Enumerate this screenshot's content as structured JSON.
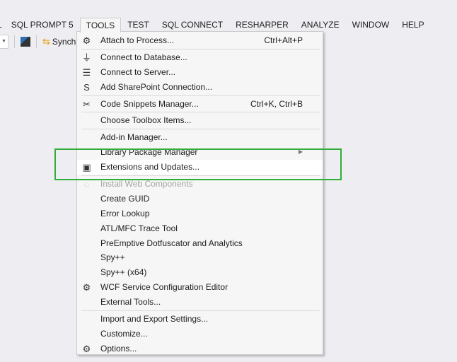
{
  "menubar": [
    "L",
    "SQL PROMPT 5",
    "TOOLS",
    "TEST",
    "SQL CONNECT",
    "RESHARPER",
    "ANALYZE",
    "WINDOW",
    "HELP"
  ],
  "toolbar": {
    "sync_label": "Synchr"
  },
  "menu": {
    "items": [
      {
        "label": "Attach to Process...",
        "shortcut": "Ctrl+Alt+P",
        "icon": "attach-process-icon",
        "glyph": "⚙"
      },
      {
        "label": "Connect to Database...",
        "icon": "connect-database-icon",
        "glyph": "⏚"
      },
      {
        "label": "Connect to Server...",
        "icon": "connect-server-icon",
        "glyph": "☰"
      },
      {
        "label": "Add SharePoint Connection...",
        "icon": "sharepoint-icon",
        "glyph": "S"
      },
      {
        "label": "Code Snippets Manager...",
        "shortcut": "Ctrl+K, Ctrl+B",
        "icon": "code-snippets-icon",
        "glyph": "✂"
      },
      {
        "label": "Choose Toolbox Items..."
      },
      {
        "label": "Add-in Manager..."
      },
      {
        "label": "Library Package Manager",
        "submenu": "▶"
      },
      {
        "label": "Extensions and Updates...",
        "icon": "extensions-icon",
        "glyph": "▣"
      },
      {
        "label": "Install Web Components",
        "icon": "web-components-icon",
        "glyph": "◌"
      },
      {
        "label": "Create GUID"
      },
      {
        "label": "Error Lookup"
      },
      {
        "label": "ATL/MFC Trace Tool"
      },
      {
        "label": "PreEmptive Dotfuscator and Analytics"
      },
      {
        "label": "Spy++"
      },
      {
        "label": "Spy++ (x64)"
      },
      {
        "label": "WCF Service Configuration Editor",
        "icon": "wcf-config-icon",
        "glyph": "⚙"
      },
      {
        "label": "External Tools..."
      },
      {
        "label": "Import and Export Settings..."
      },
      {
        "label": "Customize..."
      },
      {
        "label": "Options...",
        "icon": "options-gear-icon",
        "glyph": "⚙"
      }
    ]
  },
  "colors": {
    "highlight_box": "#2fae3a"
  }
}
